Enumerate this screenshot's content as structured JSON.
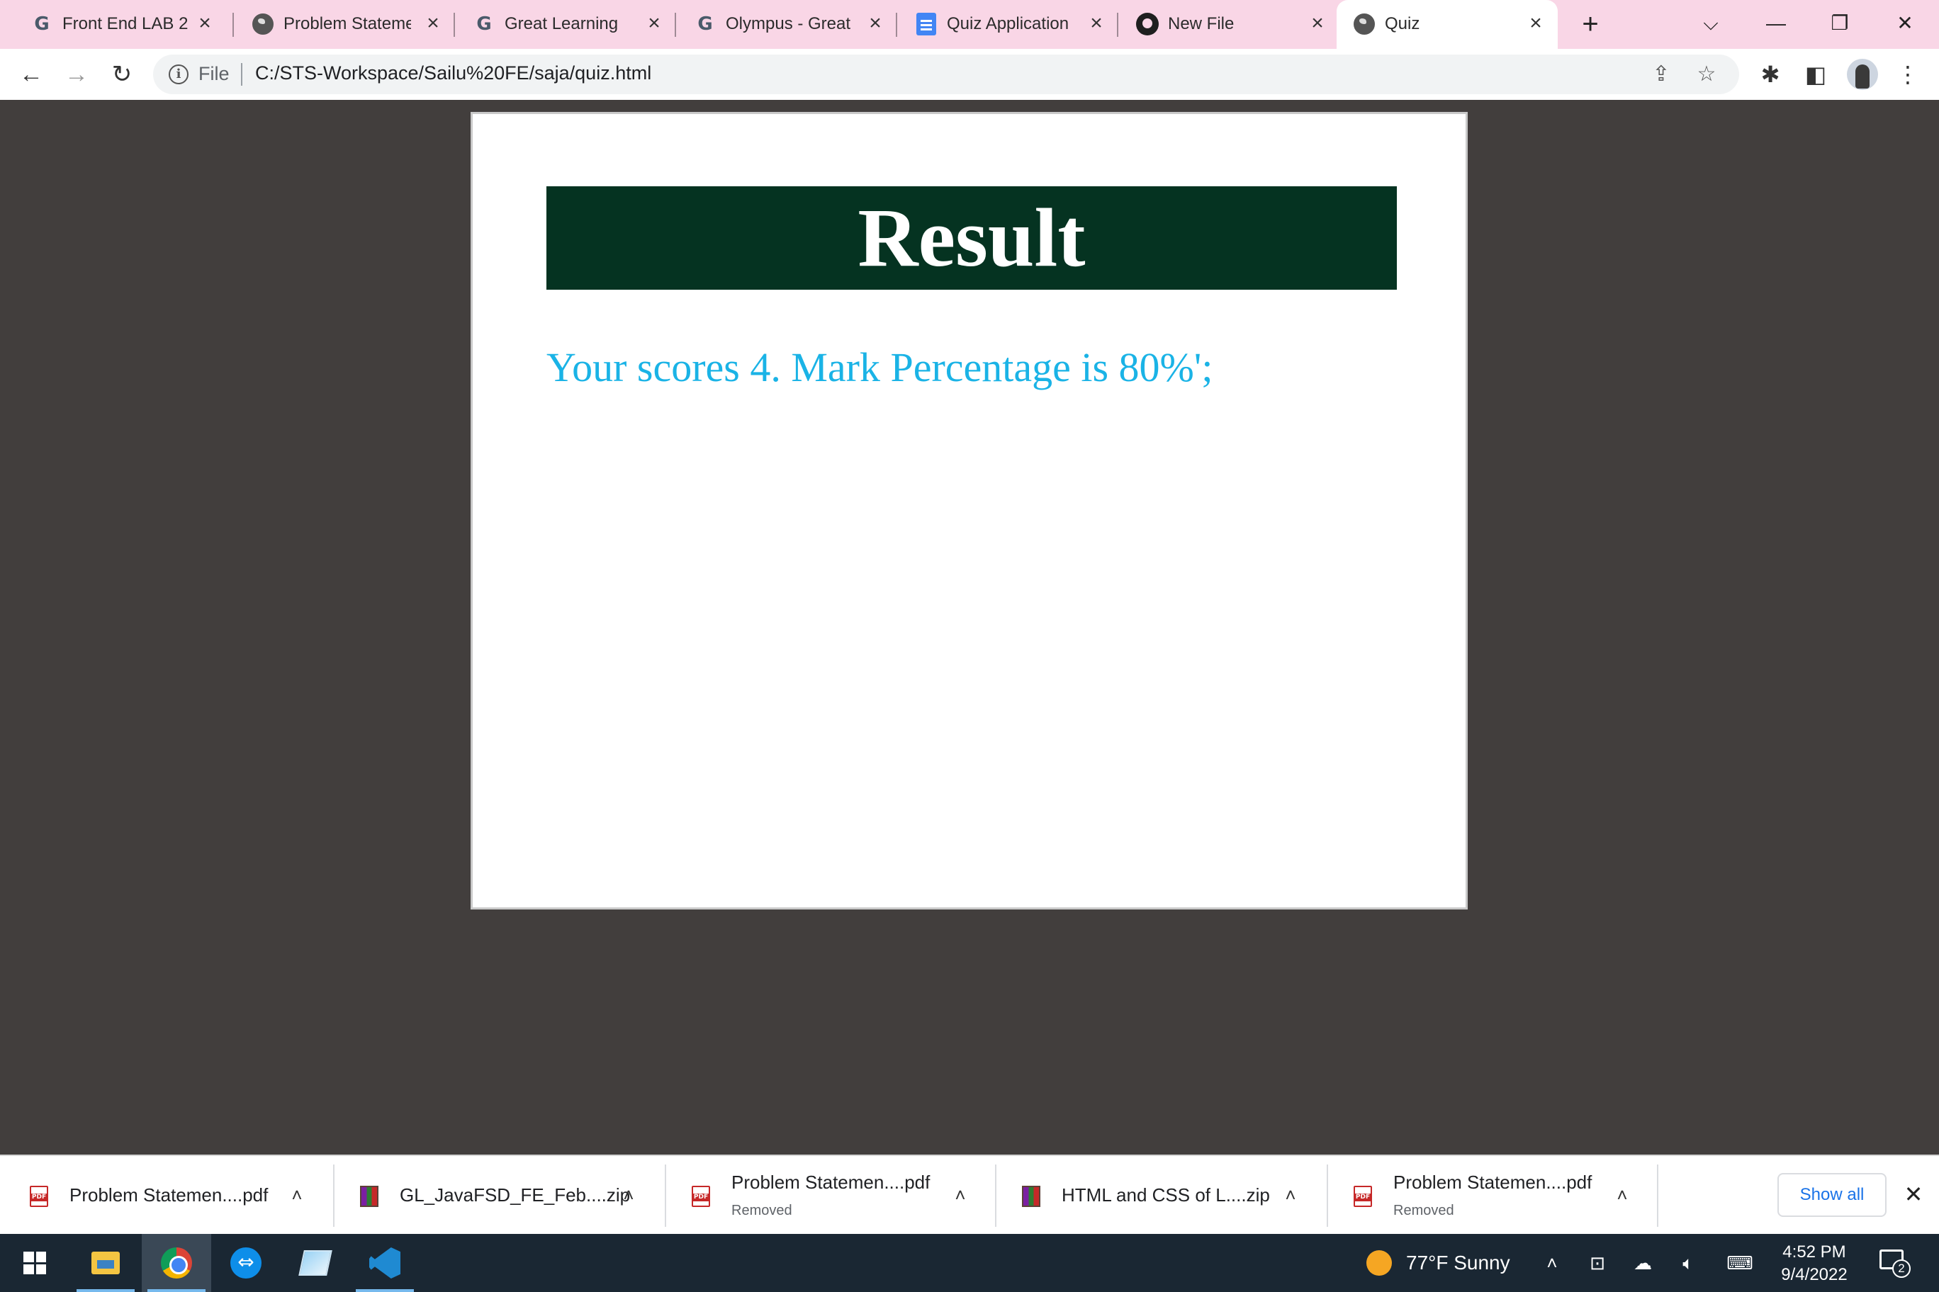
{
  "browser": {
    "tabs": [
      {
        "favicon": "google-g-icon",
        "title": "Front End LAB 2"
      },
      {
        "favicon": "globe-icon",
        "title": "Problem Stateme"
      },
      {
        "favicon": "google-g-icon",
        "title": "Great Learning"
      },
      {
        "favicon": "google-g-icon",
        "title": "Olympus - Great"
      },
      {
        "favicon": "docs-icon",
        "title": "Quiz Application"
      },
      {
        "favicon": "github-icon",
        "title": "New File"
      },
      {
        "favicon": "globe-icon",
        "title": "Quiz",
        "active": true
      }
    ],
    "address": {
      "scheme_label": "File",
      "url": "C:/STS-Workspace/Sailu%20FE/saja/quiz.html"
    }
  },
  "page": {
    "header_title": "Result",
    "score_text": "Your scores 4. Mark Percentage is 80%';"
  },
  "downloads": {
    "items": [
      {
        "type": "pdf",
        "name": "Problem Statemen....pdf",
        "status": ""
      },
      {
        "type": "zip",
        "name": "GL_JavaFSD_FE_Feb....zip",
        "status": ""
      },
      {
        "type": "pdf",
        "name": "Problem Statemen....pdf",
        "status": "Removed"
      },
      {
        "type": "zip",
        "name": "HTML and CSS of L....zip",
        "status": ""
      },
      {
        "type": "pdf",
        "name": "Problem Statemen....pdf",
        "status": "Removed"
      }
    ],
    "show_all_label": "Show all"
  },
  "taskbar": {
    "weather": "77°F  Sunny",
    "time": "4:52 PM",
    "date": "9/4/2022",
    "notification_count": "2"
  },
  "colors": {
    "header_bg": "#053321",
    "score_text": "#1ab3e6",
    "page_bg": "#423e3d",
    "tabstrip_bg": "#f9d6e6"
  }
}
